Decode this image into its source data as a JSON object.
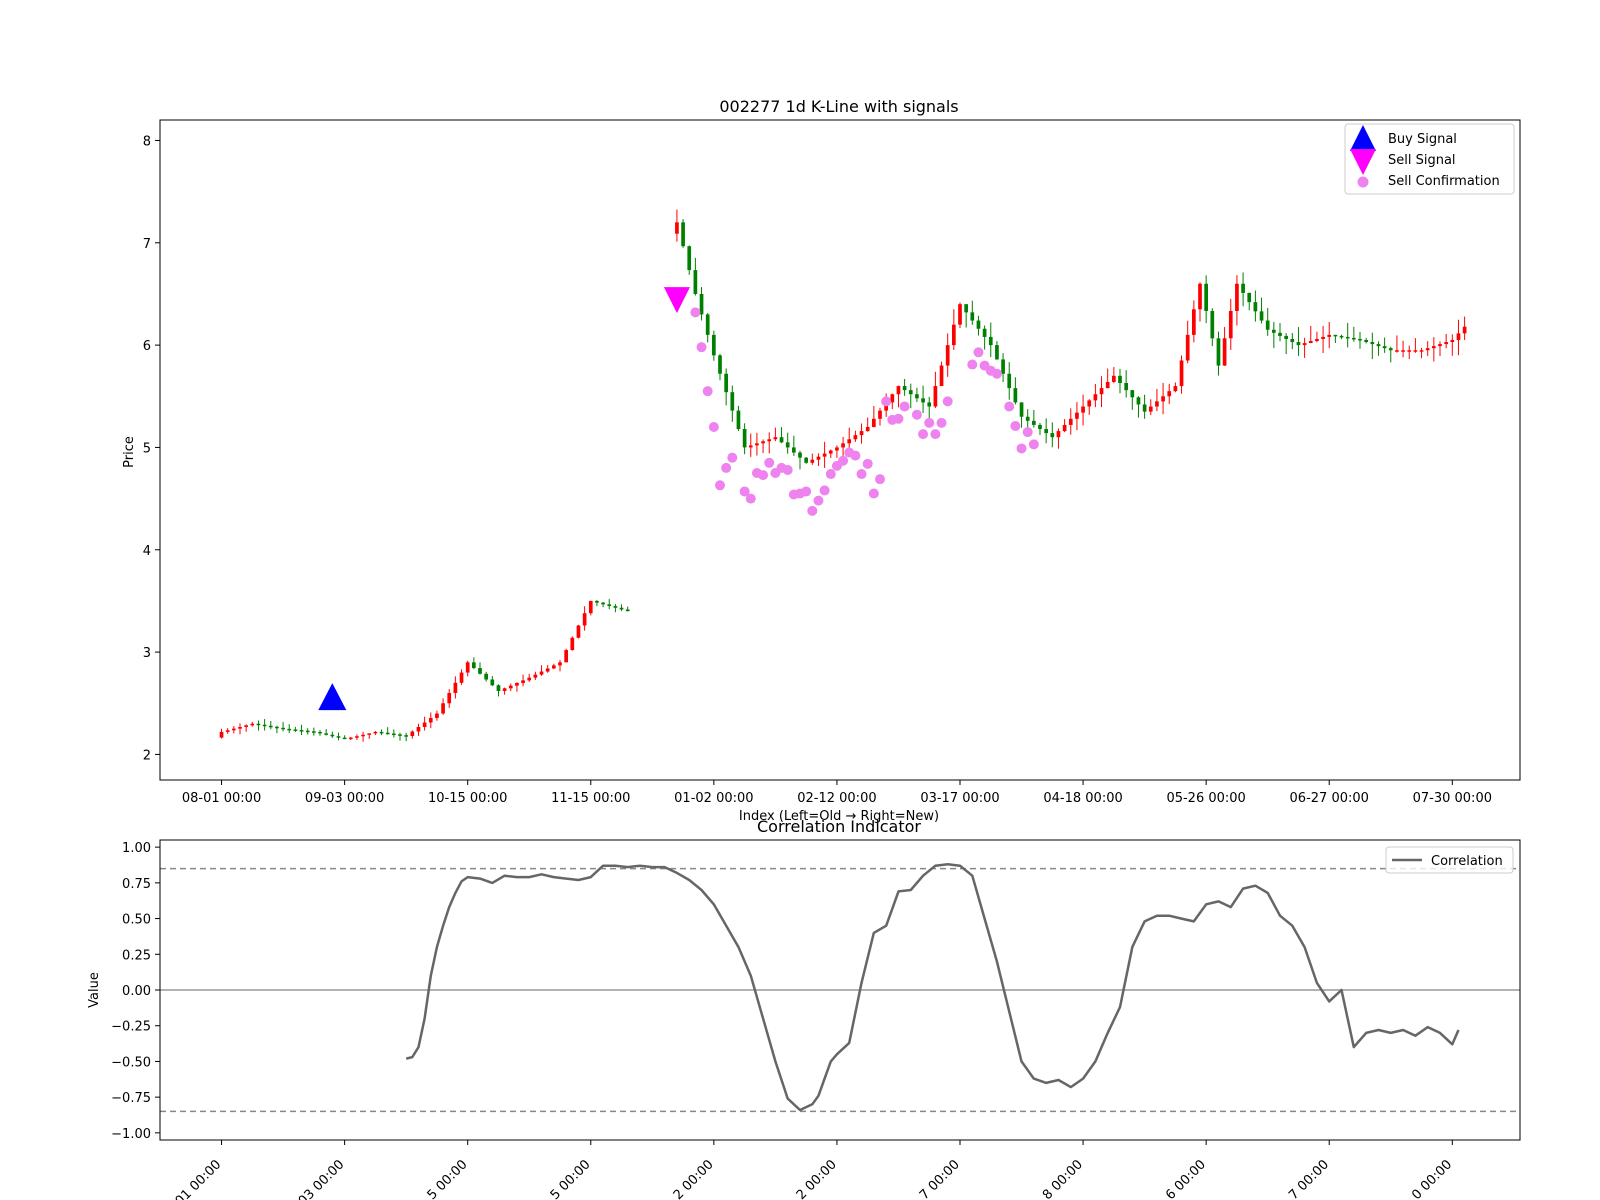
{
  "chart_data": [
    {
      "type": "candlestick",
      "title": "002277 1d K-Line with signals",
      "xlabel": "Index (Left=Old → Right=New)",
      "ylabel": "Price",
      "ylim": [
        1.75,
        8.2
      ],
      "yticks": [
        2,
        3,
        4,
        5,
        6,
        7,
        8
      ],
      "x_tick_labels": [
        "08-01 00:00",
        "09-03 00:00",
        "10-15 00:00",
        "11-15 00:00",
        "01-02 00:00",
        "02-12 00:00",
        "03-17 00:00",
        "04-18 00:00",
        "05-26 00:00",
        "06-27 00:00",
        "07-30 00:00"
      ],
      "x_tick_index": [
        0,
        20,
        40,
        60,
        80,
        100,
        120,
        140,
        160,
        180,
        200
      ],
      "xlim": [
        -10,
        211
      ],
      "grid": false,
      "legend_position": "top-right",
      "legend": [
        {
          "name": "Buy Signal",
          "marker": "triangle-up",
          "color": "#0000ff"
        },
        {
          "name": "Sell Signal",
          "marker": "triangle-down",
          "color": "#ff00ff"
        },
        {
          "name": "Sell Confirmation",
          "marker": "circle",
          "color": "#ee82ee"
        }
      ],
      "up_color": "#ff0000",
      "down_color": "#008000",
      "close_series": [
        {
          "index": 0,
          "close": 2.22
        },
        {
          "index": 5,
          "close": 2.3
        },
        {
          "index": 10,
          "close": 2.25
        },
        {
          "index": 15,
          "close": 2.22
        },
        {
          "index": 20,
          "close": 2.15
        },
        {
          "index": 25,
          "close": 2.22
        },
        {
          "index": 30,
          "close": 2.18
        },
        {
          "index": 35,
          "close": 2.4
        },
        {
          "index": 40,
          "close": 2.9
        },
        {
          "index": 45,
          "close": 2.62
        },
        {
          "index": 50,
          "close": 2.75
        },
        {
          "index": 55,
          "close": 2.9
        },
        {
          "index": 60,
          "close": 3.5
        },
        {
          "index": 66,
          "close": 3.4
        },
        {
          "index": 74,
          "close": 7.2
        },
        {
          "index": 77,
          "close": 6.5
        },
        {
          "index": 80,
          "close": 5.9
        },
        {
          "index": 85,
          "close": 5.0
        },
        {
          "index": 90,
          "close": 5.1
        },
        {
          "index": 95,
          "close": 4.85
        },
        {
          "index": 100,
          "close": 5.0
        },
        {
          "index": 105,
          "close": 5.2
        },
        {
          "index": 110,
          "close": 5.6
        },
        {
          "index": 115,
          "close": 5.4
        },
        {
          "index": 120,
          "close": 6.4
        },
        {
          "index": 125,
          "close": 6.0
        },
        {
          "index": 130,
          "close": 5.3
        },
        {
          "index": 135,
          "close": 5.1
        },
        {
          "index": 140,
          "close": 5.4
        },
        {
          "index": 145,
          "close": 5.7
        },
        {
          "index": 150,
          "close": 5.35
        },
        {
          "index": 155,
          "close": 5.6
        },
        {
          "index": 159,
          "close": 6.6
        },
        {
          "index": 162,
          "close": 5.8
        },
        {
          "index": 165,
          "close": 6.6
        },
        {
          "index": 170,
          "close": 6.15
        },
        {
          "index": 175,
          "close": 6.0
        },
        {
          "index": 180,
          "close": 6.1
        },
        {
          "index": 185,
          "close": 6.05
        },
        {
          "index": 190,
          "close": 5.95
        },
        {
          "index": 195,
          "close": 5.95
        },
        {
          "index": 200,
          "close": 6.05
        },
        {
          "index": 202,
          "close": 6.18
        }
      ],
      "buy_signals": [
        {
          "index": 18,
          "price": 2.55
        }
      ],
      "sell_signals": [
        {
          "index": 74,
          "price": 6.45
        }
      ],
      "sell_confirmations": [
        {
          "index": 77,
          "price": 6.32
        },
        {
          "index": 78,
          "price": 5.98
        },
        {
          "index": 79,
          "price": 5.55
        },
        {
          "index": 80,
          "price": 5.2
        },
        {
          "index": 81,
          "price": 4.63
        },
        {
          "index": 82,
          "price": 4.8
        },
        {
          "index": 83,
          "price": 4.9
        },
        {
          "index": 85,
          "price": 4.57
        },
        {
          "index": 86,
          "price": 4.5
        },
        {
          "index": 87,
          "price": 4.75
        },
        {
          "index": 88,
          "price": 4.73
        },
        {
          "index": 89,
          "price": 4.85
        },
        {
          "index": 90,
          "price": 4.75
        },
        {
          "index": 91,
          "price": 4.8
        },
        {
          "index": 92,
          "price": 4.78
        },
        {
          "index": 93,
          "price": 4.54
        },
        {
          "index": 94,
          "price": 4.55
        },
        {
          "index": 95,
          "price": 4.57
        },
        {
          "index": 96,
          "price": 4.38
        },
        {
          "index": 97,
          "price": 4.48
        },
        {
          "index": 98,
          "price": 4.58
        },
        {
          "index": 99,
          "price": 4.74
        },
        {
          "index": 100,
          "price": 4.82
        },
        {
          "index": 101,
          "price": 4.87
        },
        {
          "index": 102,
          "price": 4.95
        },
        {
          "index": 103,
          "price": 4.92
        },
        {
          "index": 104,
          "price": 4.74
        },
        {
          "index": 105,
          "price": 4.84
        },
        {
          "index": 106,
          "price": 4.55
        },
        {
          "index": 107,
          "price": 4.69
        },
        {
          "index": 108,
          "price": 5.45
        },
        {
          "index": 109,
          "price": 5.27
        },
        {
          "index": 110,
          "price": 5.28
        },
        {
          "index": 111,
          "price": 5.4
        },
        {
          "index": 113,
          "price": 5.32
        },
        {
          "index": 114,
          "price": 5.13
        },
        {
          "index": 115,
          "price": 5.24
        },
        {
          "index": 116,
          "price": 5.13
        },
        {
          "index": 117,
          "price": 5.24
        },
        {
          "index": 118,
          "price": 5.45
        },
        {
          "index": 122,
          "price": 5.81
        },
        {
          "index": 123,
          "price": 5.93
        },
        {
          "index": 124,
          "price": 5.8
        },
        {
          "index": 125,
          "price": 5.75
        },
        {
          "index": 126,
          "price": 5.72
        },
        {
          "index": 128,
          "price": 5.4
        },
        {
          "index": 129,
          "price": 5.21
        },
        {
          "index": 130,
          "price": 4.99
        },
        {
          "index": 131,
          "price": 5.15
        },
        {
          "index": 132,
          "price": 5.03
        }
      ]
    },
    {
      "type": "line",
      "title": "Correlation Indicator",
      "ylabel": "Value",
      "ylim": [
        -1.05,
        1.05
      ],
      "yticks": [
        "1.00",
        "0.75",
        "0.50",
        "0.25",
        "0.00",
        "−0.25",
        "−0.50",
        "−0.75",
        "−1.00"
      ],
      "ytick_values": [
        1.0,
        0.75,
        0.5,
        0.25,
        0.0,
        -0.25,
        -0.5,
        -0.75,
        -1.0
      ],
      "x_tick_labels_partial": [
        "01 00:00",
        "03 00:00",
        "5 00:00",
        "5 00:00",
        "2 00:00",
        "2 00:00",
        "7 00:00",
        "8 00:00",
        "6 00:00",
        "7 00:00",
        "0 00:00"
      ],
      "x_tick_index": [
        0,
        20,
        40,
        60,
        80,
        100,
        120,
        140,
        160,
        180,
        200
      ],
      "xlim": [
        -10,
        211
      ],
      "threshold_lines": [
        0.85,
        -0.85
      ],
      "zero_line": 0,
      "legend_position": "top-right",
      "series": [
        {
          "name": "Correlation",
          "color": "#666666",
          "x": [
            30,
            31,
            32,
            33,
            34,
            35,
            36,
            37,
            38,
            39,
            40,
            42,
            44,
            46,
            48,
            50,
            52,
            54,
            56,
            58,
            60,
            62,
            64,
            66,
            68,
            70,
            72,
            74,
            76,
            78,
            80,
            82,
            84,
            86,
            88,
            90,
            92,
            94,
            96,
            97,
            98,
            99,
            100,
            102,
            104,
            106,
            108,
            110,
            112,
            114,
            116,
            118,
            120,
            122,
            124,
            126,
            128,
            130,
            132,
            134,
            136,
            138,
            140,
            142,
            144,
            146,
            148,
            150,
            152,
            154,
            156,
            158,
            160,
            162,
            164,
            166,
            168,
            170,
            172,
            174,
            176,
            178,
            180,
            182,
            184,
            186,
            188,
            190,
            192,
            194,
            196,
            198,
            200,
            201
          ],
          "values": [
            -0.48,
            -0.47,
            -0.4,
            -0.2,
            0.1,
            0.3,
            0.45,
            0.58,
            0.68,
            0.76,
            0.79,
            0.78,
            0.75,
            0.8,
            0.79,
            0.79,
            0.81,
            0.79,
            0.78,
            0.77,
            0.79,
            0.87,
            0.87,
            0.86,
            0.87,
            0.86,
            0.86,
            0.82,
            0.77,
            0.7,
            0.6,
            0.45,
            0.3,
            0.1,
            -0.2,
            -0.5,
            -0.76,
            -0.84,
            -0.8,
            -0.74,
            -0.62,
            -0.5,
            -0.45,
            -0.37,
            0.05,
            0.4,
            0.45,
            0.69,
            0.7,
            0.8,
            0.87,
            0.88,
            0.87,
            0.8,
            0.5,
            0.2,
            -0.15,
            -0.5,
            -0.62,
            -0.65,
            -0.63,
            -0.68,
            -0.62,
            -0.5,
            -0.3,
            -0.12,
            0.3,
            0.48,
            0.52,
            0.52,
            0.5,
            0.48,
            0.6,
            0.62,
            0.58,
            0.71,
            0.73,
            0.68,
            0.52,
            0.45,
            0.3,
            0.05,
            -0.08,
            0.0,
            -0.4,
            -0.3,
            -0.28,
            -0.3,
            -0.28,
            -0.32,
            -0.26,
            -0.3,
            -0.38,
            -0.28
          ]
        }
      ]
    }
  ]
}
